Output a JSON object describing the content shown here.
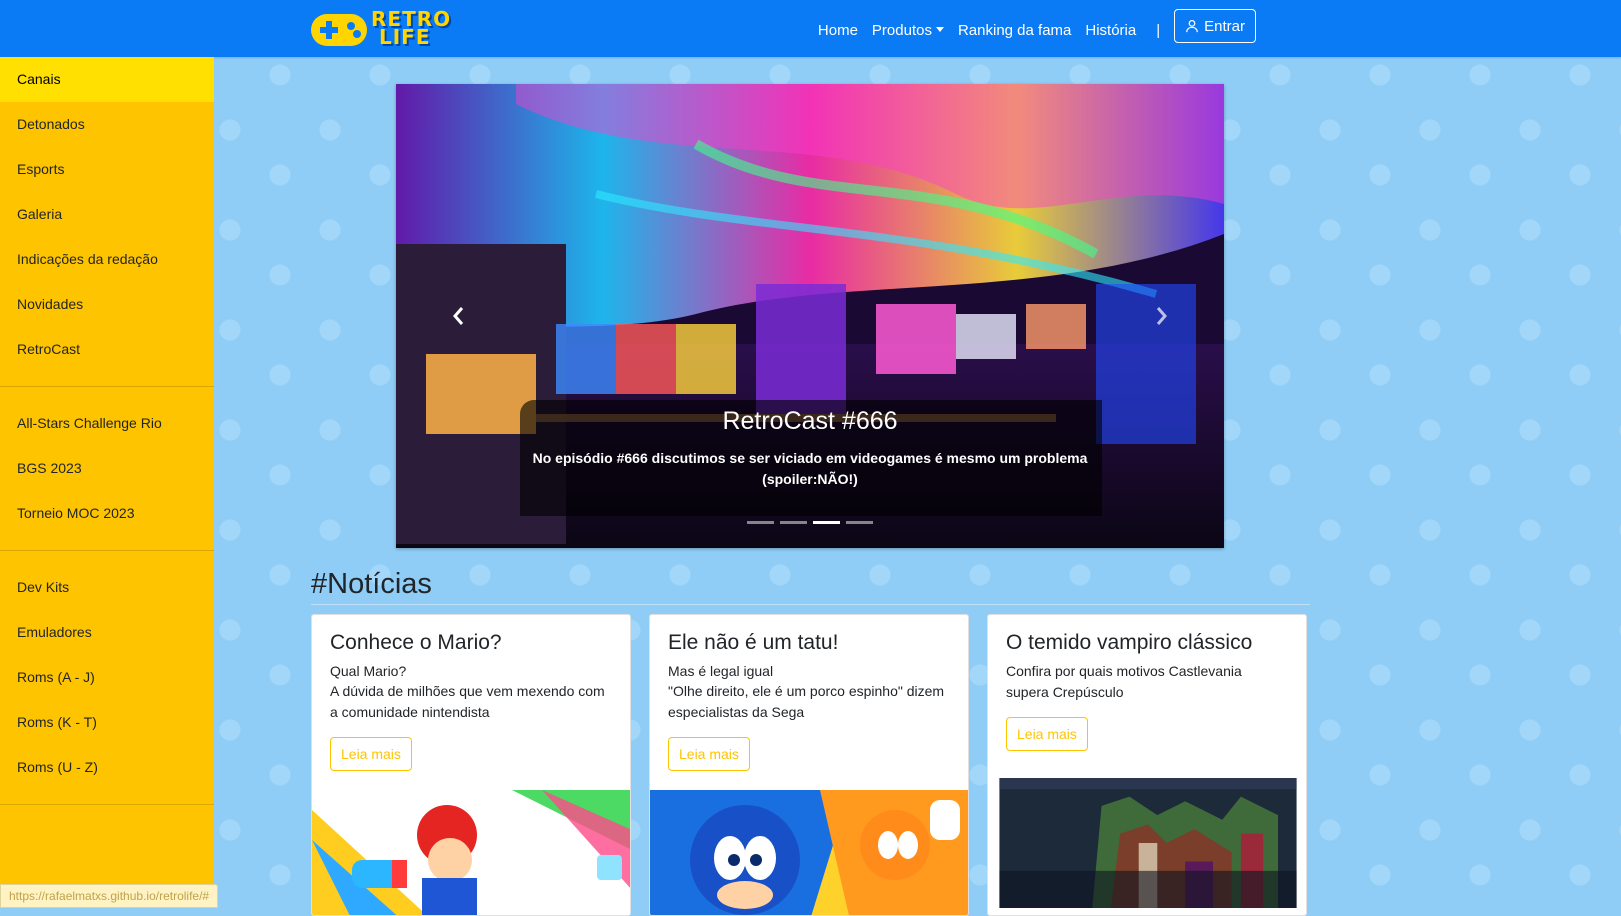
{
  "header": {
    "logo_line1": "RETRO",
    "logo_line2": "LIFE",
    "nav": [
      "Home",
      "Produtos",
      "Ranking da fama",
      "História"
    ],
    "separator": "|",
    "login_label": "Entrar",
    "brand_color": "#0a7bf5",
    "accent_color": "#ffd400"
  },
  "sidebar": {
    "groups": [
      [
        "Canais",
        "Detonados",
        "Esports",
        "Galeria",
        "Indicações da redação",
        "Novidades",
        "RetroCast"
      ],
      [
        "All-Stars Challenge Rio",
        "BGS 2023",
        "Torneio MOC 2023"
      ],
      [
        "Dev Kits",
        "Emuladores",
        "Roms (A - J)",
        "Roms (K - T)",
        "Roms (U - Z)"
      ]
    ],
    "active": "Canais"
  },
  "carousel": {
    "title": "RetroCast #666",
    "text": "No episódio #666 discutimos se ser viciado em videogames é mesmo um problema (spoiler:NÃO!)",
    "slide_count": 4,
    "active_slide": 3,
    "prev_icon": "chevron-left-icon",
    "next_icon": "chevron-right-icon"
  },
  "news": {
    "heading": "#Notícias",
    "cards": [
      {
        "title": "Conhece o Mario?",
        "subtitle": "Qual Mario?",
        "text": "A dúvida de milhões que vem mexendo com a comunidade nintendista",
        "button": "Leia mais"
      },
      {
        "title": "Ele não é um tatu!",
        "subtitle": "Mas é legal igual",
        "text": "\"Olhe direito, ele é um porco espinho\" dizem especialistas da Sega",
        "button": "Leia mais"
      },
      {
        "title": "O temido vampiro clássico",
        "subtitle": "",
        "text": "Confira por quais motivos Castlevania supera Crepúsculo",
        "button": "Leia mais"
      }
    ]
  },
  "status_url": "https://rafaelmatxs.github.io/retrolife/#"
}
